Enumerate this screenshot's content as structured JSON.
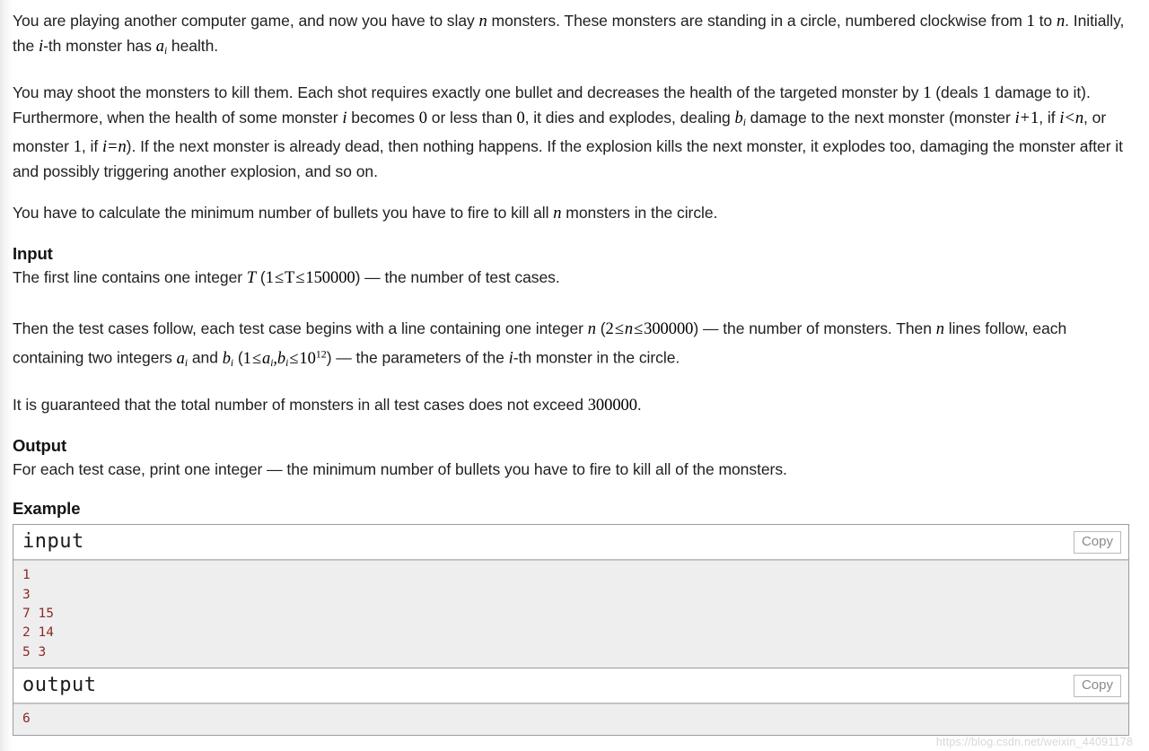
{
  "problem": {
    "paragraphs": [
      {
        "id": "p1",
        "parts": [
          {
            "t": "text",
            "v": "You are playing another computer game, and now you have to slay "
          },
          {
            "t": "math",
            "v": "n"
          },
          {
            "t": "text",
            "v": " monsters. These monsters are standing in a circle, numbered clockwise from "
          },
          {
            "t": "num",
            "v": "1"
          },
          {
            "t": "text",
            "v": " to "
          },
          {
            "t": "math",
            "v": "n"
          },
          {
            "t": "text",
            "v": ". Initially, the "
          },
          {
            "t": "math",
            "v": "i"
          },
          {
            "t": "text",
            "v": "-th monster has "
          },
          {
            "t": "mathsub",
            "v": "a",
            "sub": "i"
          },
          {
            "t": "text",
            "v": " health."
          }
        ]
      },
      {
        "id": "p2",
        "parts": [
          {
            "t": "text",
            "v": "You may shoot the monsters to kill them. Each shot requires exactly one bullet and decreases the health of the targeted monster by "
          },
          {
            "t": "num",
            "v": "1"
          },
          {
            "t": "text",
            "v": " (deals "
          },
          {
            "t": "num",
            "v": "1"
          },
          {
            "t": "text",
            "v": " damage to it). Furthermore, when the health of some monster "
          },
          {
            "t": "math",
            "v": "i"
          },
          {
            "t": "text",
            "v": " becomes "
          },
          {
            "t": "num",
            "v": "0"
          },
          {
            "t": "text",
            "v": " or less than "
          },
          {
            "t": "num",
            "v": "0"
          },
          {
            "t": "text",
            "v": ", it dies and explodes, dealing "
          },
          {
            "t": "mathsub",
            "v": "b",
            "sub": "i"
          },
          {
            "t": "text",
            "v": " damage to the next monster (monster "
          },
          {
            "t": "math",
            "v": "i + 1"
          },
          {
            "t": "text",
            "v": ", if "
          },
          {
            "t": "math",
            "v": "i < n"
          },
          {
            "t": "text",
            "v": ", or monster "
          },
          {
            "t": "num",
            "v": "1"
          },
          {
            "t": "text",
            "v": ", if "
          },
          {
            "t": "math",
            "v": "i = n"
          },
          {
            "t": "text",
            "v": "). If the next monster is already dead, then nothing happens. If the explosion kills the next monster, it explodes too, damaging the monster after it and possibly triggering another explosion, and so on."
          }
        ]
      },
      {
        "id": "p3",
        "parts": [
          {
            "t": "text",
            "v": "You have to calculate the minimum number of bullets you have to fire to kill all "
          },
          {
            "t": "math",
            "v": "n"
          },
          {
            "t": "text",
            "v": " monsters in the circle."
          }
        ]
      }
    ],
    "input_section": {
      "heading": "Input",
      "paragraphs": [
        {
          "id": "in1",
          "parts": [
            {
              "t": "text",
              "v": "The first line contains one integer "
            },
            {
              "t": "math",
              "v": "T"
            },
            {
              "t": "text",
              "v": " ("
            },
            {
              "t": "num",
              "v": "1 ≤ T ≤ 150000"
            },
            {
              "t": "text",
              "v": ") — the number of test cases."
            }
          ]
        },
        {
          "id": "in2",
          "parts": [
            {
              "t": "text",
              "v": "Then the test cases follow, each test case begins with a line containing one integer "
            },
            {
              "t": "math",
              "v": "n"
            },
            {
              "t": "text",
              "v": " ("
            },
            {
              "t": "num",
              "v": "2 ≤ n ≤ 300000"
            },
            {
              "t": "text",
              "v": ") — the number of monsters. Then "
            },
            {
              "t": "math",
              "v": "n"
            },
            {
              "t": "text",
              "v": " lines follow, each containing two integers "
            },
            {
              "t": "mathsub",
              "v": "a",
              "sub": "i"
            },
            {
              "t": "text",
              "v": " and "
            },
            {
              "t": "mathsub",
              "v": "b",
              "sub": "i"
            },
            {
              "t": "text",
              "v": " ("
            },
            {
              "t": "numexp",
              "v": "1 ≤ a_i, b_i ≤ 10^12"
            },
            {
              "t": "text",
              "v": ") — the parameters of the "
            },
            {
              "t": "math",
              "v": "i"
            },
            {
              "t": "text",
              "v": "-th monster in the circle."
            }
          ]
        },
        {
          "id": "in3",
          "parts": [
            {
              "t": "text",
              "v": "It is guaranteed that the total number of monsters in all test cases does not exceed "
            },
            {
              "t": "num",
              "v": "300000"
            },
            {
              "t": "text",
              "v": "."
            }
          ]
        }
      ]
    },
    "output_section": {
      "heading": "Output",
      "text": "For each test case, print one integer — the minimum number of bullets you have to fire to kill all of the monsters."
    },
    "example_section": {
      "heading": "Example",
      "blocks": [
        {
          "title": "input",
          "copy_label": "Copy",
          "content": "1\n3\n7 15\n2 14\n5 3"
        },
        {
          "title": "output",
          "copy_label": "Copy",
          "content": "6"
        }
      ]
    }
  },
  "watermark": "https://blog.csdn.net/weixin_44091178",
  "colors": {
    "sample_text": "#8c2a28",
    "body_text": "#1f1f1f",
    "border": "#9c9c9c",
    "sample_bg": "#eeeeee"
  }
}
